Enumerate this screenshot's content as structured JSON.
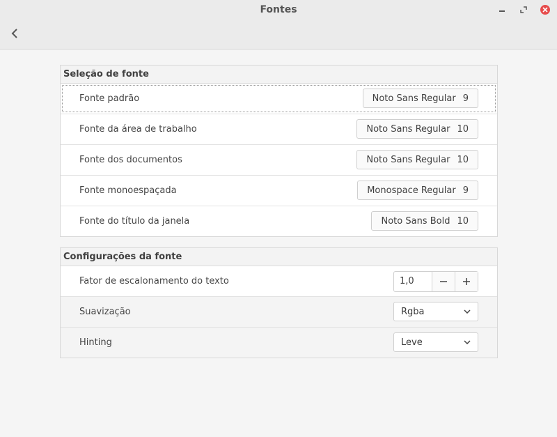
{
  "window": {
    "title": "Fontes"
  },
  "font_selection": {
    "header": "Seleção de fonte",
    "rows": [
      {
        "label": "Fonte padrão",
        "font": "Noto Sans Regular",
        "size": "9"
      },
      {
        "label": "Fonte da área de trabalho",
        "font": "Noto Sans Regular",
        "size": "10"
      },
      {
        "label": "Fonte dos documentos",
        "font": "Noto Sans Regular",
        "size": "10"
      },
      {
        "label": "Fonte monoespaçada",
        "font": "Monospace Regular",
        "size": "9"
      },
      {
        "label": "Fonte do título da janela",
        "font": "Noto Sans Bold",
        "size": "10"
      }
    ]
  },
  "font_config": {
    "header": "Configurações da fonte",
    "scale": {
      "label": "Fator de escalonamento do texto",
      "value": "1,0"
    },
    "antialiasing": {
      "label": "Suavização",
      "value": "Rgba"
    },
    "hinting": {
      "label": "Hinting",
      "value": "Leve"
    }
  },
  "icons": [
    "back-arrow-icon",
    "minimize-icon",
    "maximize-icon",
    "close-icon",
    "minus-icon",
    "plus-icon",
    "chevron-down-icon"
  ],
  "colors": {
    "close_button": "#e74c4c",
    "background": "#f5f5f5"
  }
}
